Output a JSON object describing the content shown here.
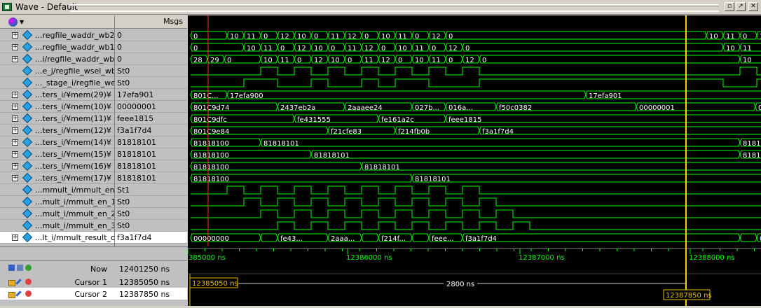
{
  "window": {
    "title": "Wave - Default"
  },
  "columns": {
    "msgs": "Msgs"
  },
  "signals": [
    {
      "name": "...regfile_waddr_wb2",
      "value": "0",
      "expandable": true,
      "type": "bus",
      "segments": [
        [
          0,
          "0"
        ],
        [
          52,
          "10"
        ],
        [
          76,
          "11"
        ],
        [
          100,
          "0"
        ],
        [
          124,
          "12"
        ],
        [
          148,
          "10"
        ],
        [
          172,
          "0"
        ],
        [
          196,
          "11"
        ],
        [
          220,
          "12"
        ],
        [
          244,
          "0"
        ],
        [
          268,
          "10"
        ],
        [
          292,
          "11"
        ],
        [
          316,
          "0"
        ],
        [
          340,
          "12"
        ],
        [
          364,
          "0"
        ],
        [
          736,
          "10"
        ],
        [
          760,
          "11"
        ],
        [
          784,
          "0"
        ],
        [
          808,
          "1"
        ]
      ]
    },
    {
      "name": "...regfile_waddr_wb1",
      "value": "0",
      "expandable": true,
      "type": "bus",
      "segments": [
        [
          0,
          "0"
        ],
        [
          76,
          "10"
        ],
        [
          100,
          "11"
        ],
        [
          124,
          "0"
        ],
        [
          148,
          "12"
        ],
        [
          172,
          "10"
        ],
        [
          196,
          "0"
        ],
        [
          220,
          "11"
        ],
        [
          244,
          "12"
        ],
        [
          268,
          "0"
        ],
        [
          292,
          "10"
        ],
        [
          316,
          "11"
        ],
        [
          340,
          "0"
        ],
        [
          364,
          "12"
        ],
        [
          388,
          "0"
        ],
        [
          760,
          "10"
        ],
        [
          784,
          "11"
        ]
      ]
    },
    {
      "name": "...i/regfile_waddr_wb",
      "value": "0",
      "expandable": true,
      "type": "bus",
      "segments": [
        [
          0,
          "28"
        ],
        [
          24,
          "29"
        ],
        [
          48,
          "0"
        ],
        [
          100,
          "10"
        ],
        [
          124,
          "11"
        ],
        [
          148,
          "0"
        ],
        [
          172,
          "12"
        ],
        [
          196,
          "10"
        ],
        [
          220,
          "0"
        ],
        [
          244,
          "11"
        ],
        [
          268,
          "12"
        ],
        [
          292,
          "0"
        ],
        [
          316,
          "10"
        ],
        [
          340,
          "11"
        ],
        [
          364,
          "0"
        ],
        [
          388,
          "12"
        ],
        [
          412,
          "0"
        ],
        [
          784,
          "10"
        ]
      ]
    },
    {
      "name": "...e_j/regfile_wsel_wb",
      "value": "St0",
      "expandable": false,
      "type": "bit",
      "edges": [
        0,
        100,
        124,
        148,
        172,
        196,
        220,
        244,
        268,
        292,
        316,
        340,
        364,
        388,
        412,
        784,
        808
      ],
      "start": 0
    },
    {
      "name": "..._stage_i/regfile_we",
      "value": "St0",
      "expandable": false,
      "type": "bit",
      "edges": [
        0,
        76,
        124,
        172,
        196,
        244,
        268,
        292,
        340,
        412,
        760,
        808
      ],
      "start": 0
    },
    {
      "name": "...ters_i/¥mem(29)¥",
      "value": "17efa901",
      "expandable": true,
      "type": "bus",
      "segments": [
        [
          0,
          "801C..."
        ],
        [
          52,
          "17efa900"
        ],
        [
          564,
          "17efa901"
        ]
      ]
    },
    {
      "name": "...ters_i/¥mem(10)¥",
      "value": "00000001",
      "expandable": true,
      "type": "bus",
      "segments": [
        [
          0,
          "801C9d74"
        ],
        [
          124,
          "2437eb2a"
        ],
        [
          220,
          "2aaaee24"
        ],
        [
          316,
          "027b..."
        ],
        [
          364,
          "016a..."
        ],
        [
          436,
          "f50c0382"
        ],
        [
          636,
          "00000001"
        ],
        [
          806,
          "0"
        ]
      ]
    },
    {
      "name": "...ters_i/¥mem(11)¥",
      "value": "feee1815",
      "expandable": true,
      "type": "bus",
      "segments": [
        [
          0,
          "801C9dfc"
        ],
        [
          148,
          "fe431555"
        ],
        [
          268,
          "fe161a2c"
        ],
        [
          364,
          "feee1815"
        ]
      ]
    },
    {
      "name": "...ters_i/¥mem(12)¥",
      "value": "f3a1f7d4",
      "expandable": true,
      "type": "bus",
      "segments": [
        [
          0,
          "801C9e84"
        ],
        [
          196,
          "f21cfe83"
        ],
        [
          292,
          "f214fb0b"
        ],
        [
          412,
          "f3a1f7d4"
        ]
      ]
    },
    {
      "name": "...ters_i/¥mem(14)¥",
      "value": "81818101",
      "expandable": true,
      "type": "bus",
      "segments": [
        [
          0,
          "81818100"
        ],
        [
          100,
          "81818101"
        ],
        [
          784,
          "81818"
        ]
      ]
    },
    {
      "name": "...ters_i/¥mem(15)¥",
      "value": "81818101",
      "expandable": true,
      "type": "bus",
      "segments": [
        [
          0,
          "81818100"
        ],
        [
          172,
          "81818101"
        ],
        [
          784,
          "81818"
        ]
      ]
    },
    {
      "name": "...ters_i/¥mem(16)¥",
      "value": "81818101",
      "expandable": true,
      "type": "bus",
      "segments": [
        [
          0,
          "81818100"
        ],
        [
          244,
          "81818101"
        ]
      ]
    },
    {
      "name": "...ters_i/¥mem(17)¥",
      "value": "81818101",
      "expandable": true,
      "type": "bus",
      "segments": [
        [
          0,
          "81818100"
        ],
        [
          316,
          "81818101"
        ]
      ]
    },
    {
      "name": "...mmult_i/mmult_en_i",
      "value": "St1",
      "expandable": false,
      "type": "bit",
      "edges": [
        0,
        52,
        76,
        100,
        124,
        148,
        172,
        196,
        220,
        244,
        268,
        292,
        316,
        340,
        364,
        388,
        412
      ],
      "start": 0
    },
    {
      "name": "...mult_i/mmult_en_1",
      "value": "St0",
      "expandable": false,
      "type": "bit",
      "edges": [
        0,
        76,
        100,
        124,
        148,
        172,
        196,
        220,
        244,
        268,
        292,
        316,
        340,
        364,
        388,
        412,
        436
      ],
      "start": 0
    },
    {
      "name": "...mult_i/mmult_en_2",
      "value": "St0",
      "expandable": false,
      "type": "bit",
      "edges": [
        0,
        100,
        124,
        148,
        172,
        196,
        220,
        244,
        268,
        292,
        316,
        340,
        364,
        388,
        412,
        436,
        460
      ],
      "start": 0
    },
    {
      "name": "...mult_i/mmult_en_3",
      "value": "St0",
      "expandable": false,
      "type": "bit",
      "edges": [
        0,
        124,
        148,
        172,
        196,
        220,
        244,
        268,
        292,
        316,
        340,
        364,
        388,
        412,
        436,
        460,
        484
      ],
      "start": 0
    },
    {
      "name": "...lt_i/mmult_result_o",
      "value": "f3a1f7d4",
      "expandable": true,
      "type": "bus",
      "selected": true,
      "segments": [
        [
          0,
          "00000000"
        ],
        [
          100,
          ""
        ],
        [
          124,
          "fe43..."
        ],
        [
          196,
          "2aaa..."
        ],
        [
          244,
          ""
        ],
        [
          268,
          "f214f..."
        ],
        [
          316,
          ""
        ],
        [
          340,
          "feee..."
        ],
        [
          388,
          "f3a1f7d4"
        ],
        [
          784,
          ""
        ],
        [
          808,
          "0"
        ]
      ]
    }
  ],
  "status": {
    "now_label": "Now",
    "now_value": "12401250 ns",
    "cursor1_label": "Cursor 1",
    "cursor1_value": "12385050 ns",
    "cursor2_label": "Cursor 2",
    "cursor2_value": "12387850 ns"
  },
  "timeline": {
    "ticks": [
      {
        "label": "385000 ns",
        "t": 12385000
      },
      {
        "label": "12386000 ns",
        "t": 12386000
      },
      {
        "label": "12387000 ns",
        "t": 12387000
      },
      {
        "label": "12388000 ns",
        "t": 12388000
      }
    ],
    "cursor1_tag": "12385050 ns",
    "cursor2_tag": "12387850 ns",
    "delta_label": "2800 ns"
  },
  "colors": {
    "wave": "#00ff00",
    "cursor": "#e8c000",
    "selected_cursor": "#ffd000",
    "cursor_red": "#ff3030"
  }
}
